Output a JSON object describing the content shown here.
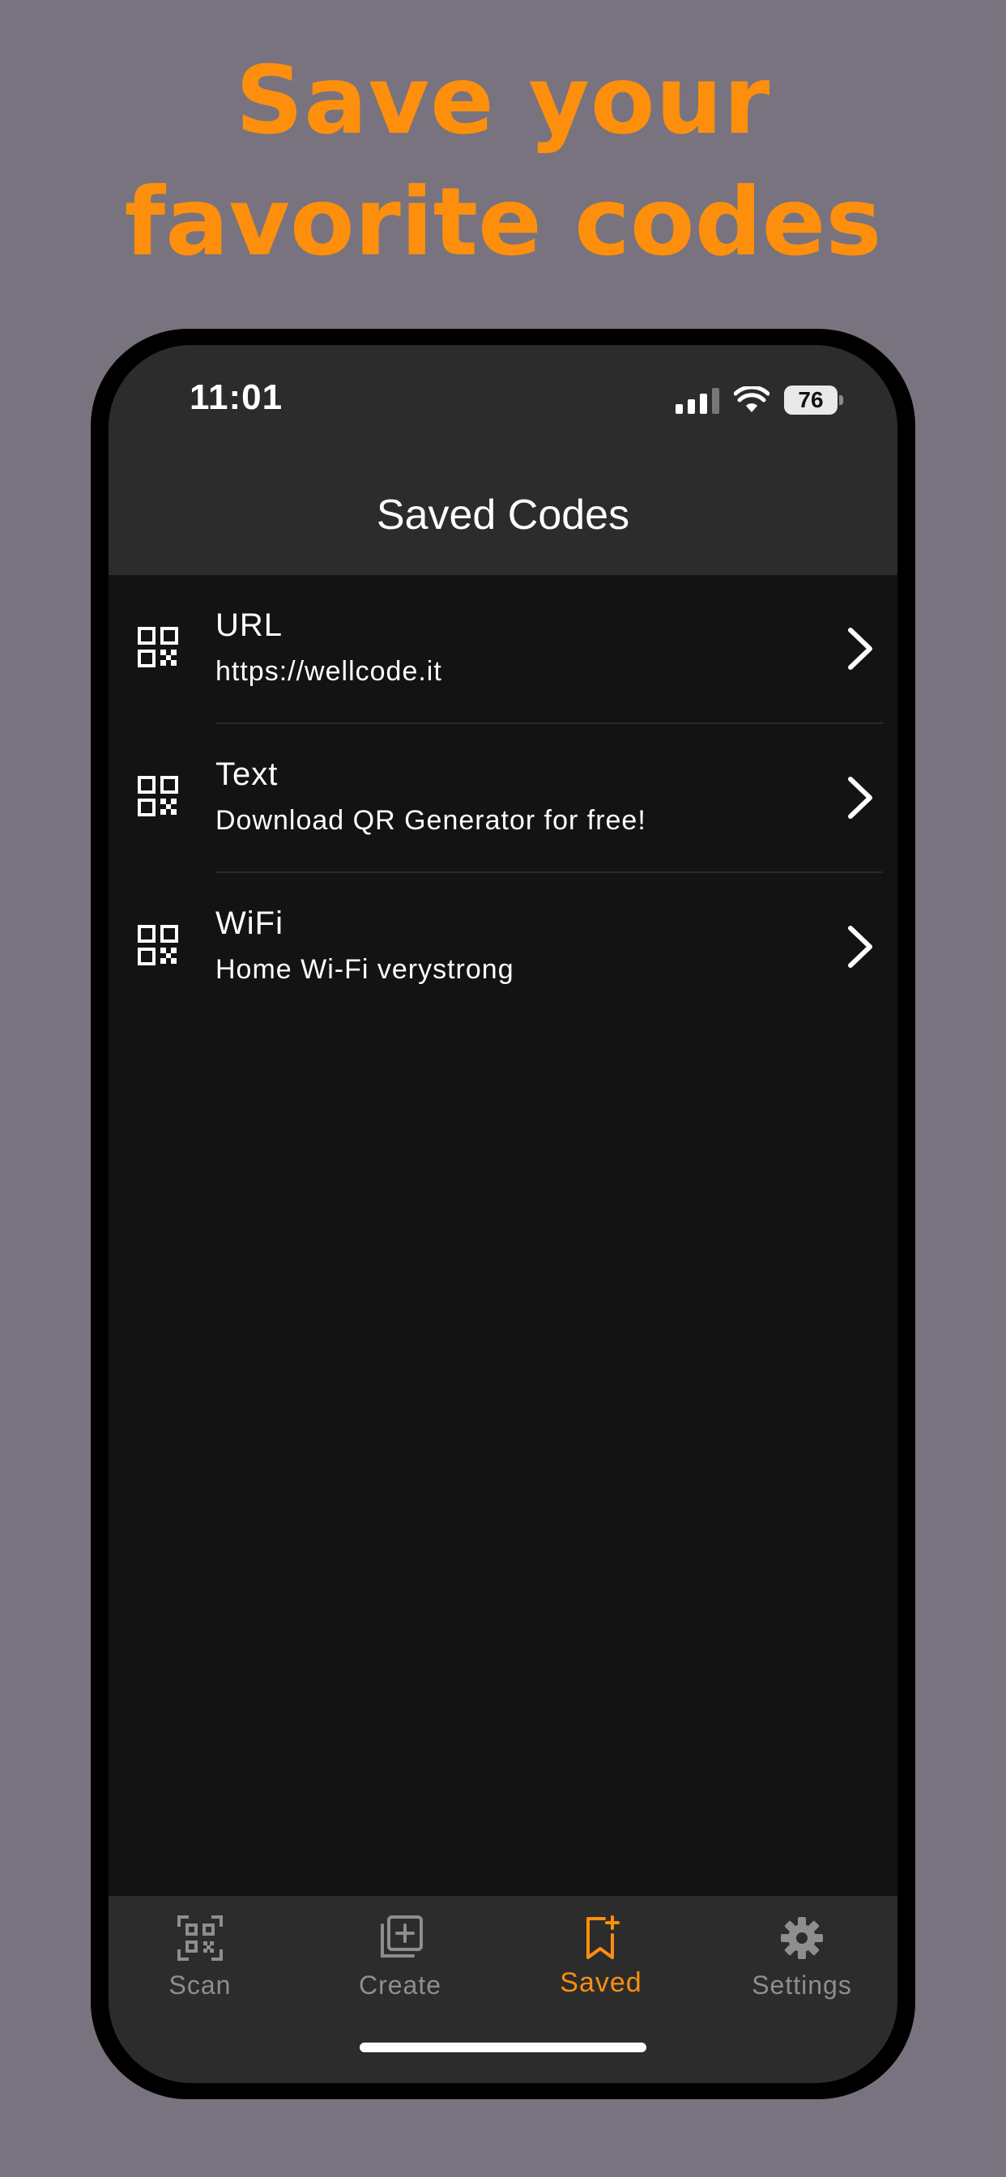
{
  "headline": {
    "line1": "Save your",
    "line2": "favorite codes"
  },
  "status_bar": {
    "time": "11:01",
    "battery": "76",
    "signal_bars_active": 3,
    "signal_bars_total": 4
  },
  "nav": {
    "title": "Saved Codes"
  },
  "items": [
    {
      "type": "URL",
      "value": "https://wellcode.it"
    },
    {
      "type": "Text",
      "value": "Download QR Generator for free!"
    },
    {
      "type": "WiFi",
      "value": "Home Wi-Fi  verystrong"
    }
  ],
  "tabs": [
    {
      "label": "Scan",
      "icon": "scan-qr-icon",
      "active": false
    },
    {
      "label": "Create",
      "icon": "add-square-icon",
      "active": false
    },
    {
      "label": "Saved",
      "icon": "bookmark-plus-icon",
      "active": true
    },
    {
      "label": "Settings",
      "icon": "gear-icon",
      "active": false
    }
  ],
  "colors": {
    "accent": "#fd8f0d",
    "background": "#78737e",
    "screen": "#131313",
    "bars": "#2c2c2c"
  }
}
